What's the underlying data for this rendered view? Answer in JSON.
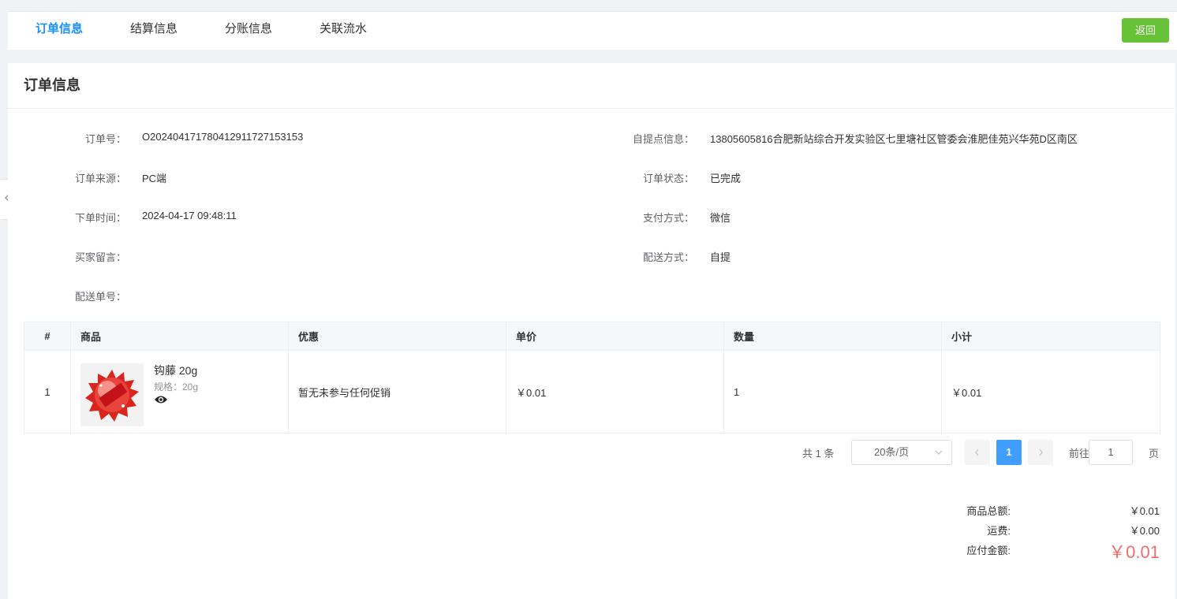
{
  "tabs": [
    {
      "label": "订单信息",
      "active": true
    },
    {
      "label": "结算信息",
      "active": false
    },
    {
      "label": "分账信息",
      "active": false
    },
    {
      "label": "关联流水",
      "active": false
    }
  ],
  "back_label": "返回",
  "card_title": "订单信息",
  "info_left": [
    {
      "label": "订单号：",
      "value": "O2024041717804129117271531 53"
    },
    {
      "label": "订单来源：",
      "value": "PC端"
    },
    {
      "label": "下单时间：",
      "value": "2024-04-17 09:48:11"
    },
    {
      "label": "买家留言：",
      "value": ""
    },
    {
      "label": "配送单号：",
      "value": ""
    }
  ],
  "info_right": [
    {
      "label": "自提点信息：",
      "value": "13805605816合肥新站综合开发实验区七里塘社区管委会淮肥佳苑兴华苑D区南区"
    },
    {
      "label": "订单状态：",
      "value": "已完成"
    },
    {
      "label": "支付方式：",
      "value": "微信"
    },
    {
      "label": "配送方式：",
      "value": "自提"
    }
  ],
  "table": {
    "headers": [
      "#",
      "商品",
      "优惠",
      "单价",
      "数量",
      "小计"
    ],
    "rows": [
      {
        "index": "1",
        "product_name": "钩藤 20g",
        "product_spec": "规格：20g",
        "promotion": "暂无未参与任何促销",
        "unit_price": "￥0.01",
        "quantity": "1",
        "subtotal": "￥0.01"
      }
    ]
  },
  "pagination": {
    "total_text": "共 1 条",
    "page_size": "20条/页",
    "current_page": "1",
    "goto_label": "前往",
    "goto_value": "1",
    "page_suffix": "页"
  },
  "summary": {
    "goods_total_label": "商品总额:",
    "goods_total_value": "￥0.01",
    "shipping_label": "运费:",
    "shipping_value": "￥0.00",
    "payable_label": "应付金额:",
    "payable_value": "￥0.01"
  },
  "colors": {
    "accent": "#1890ff",
    "back_button": "#67c23a",
    "pager_active": "#409eff",
    "payable": "#f56c6c"
  },
  "icons": {
    "side_tab": "chevron-left-icon",
    "eye": "eye-icon",
    "select_arrow": "chevron-down-icon",
    "pager_prev": "chevron-left-icon",
    "pager_next": "chevron-right-icon"
  }
}
